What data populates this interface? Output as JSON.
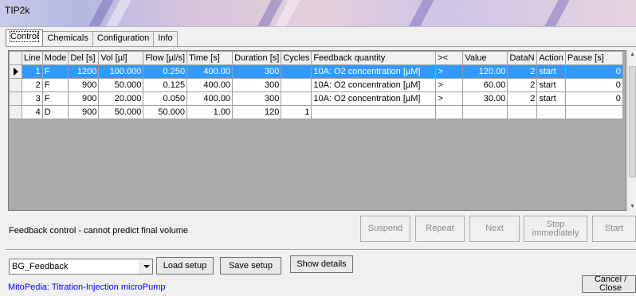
{
  "window": {
    "title": "TIP2k"
  },
  "tabs": [
    {
      "label": "Control",
      "active": true
    },
    {
      "label": "Chemicals",
      "active": false
    },
    {
      "label": "Configuration",
      "active": false
    },
    {
      "label": "Info",
      "active": false
    }
  ],
  "grid": {
    "columns": [
      "Line",
      "Mode",
      "Del [s]",
      "Vol [µl]",
      "Flow [µl/s]",
      "Time [s]",
      "Duration [s]",
      "Cycles",
      "Feedback quantity",
      "><",
      "Value",
      "DataN",
      "Action",
      "Pause [s]"
    ],
    "rows": [
      {
        "line": "1",
        "mode": "F",
        "del": "1200",
        "vol": "100.000",
        "flow": "0.250",
        "time": "400.00",
        "duration": "300",
        "cycles": "",
        "feedback": "10A: O2 concentration [µM]",
        "cmp": ">",
        "value": "120.00",
        "datan": "2",
        "action": "start",
        "pause": "0",
        "selected": true
      },
      {
        "line": "2",
        "mode": "F",
        "del": "900",
        "vol": "50.000",
        "flow": "0.125",
        "time": "400.00",
        "duration": "300",
        "cycles": "",
        "feedback": "10A: O2 concentration [µM]",
        "cmp": ">",
        "value": "60.00",
        "datan": "2",
        "action": "start",
        "pause": "0",
        "selected": false
      },
      {
        "line": "3",
        "mode": "F",
        "del": "900",
        "vol": "20.000",
        "flow": "0.050",
        "time": "400.00",
        "duration": "300",
        "cycles": "",
        "feedback": "10A: O2 concentration [µM]",
        "cmp": ">",
        "value": "30.00",
        "datan": "2",
        "action": "start",
        "pause": "0",
        "selected": false
      },
      {
        "line": "4",
        "mode": "D",
        "del": "900",
        "vol": "50.000",
        "flow": "50.000",
        "time": "1.00",
        "duration": "120",
        "cycles": "1",
        "feedback": "",
        "cmp": "",
        "value": "",
        "datan": "",
        "action": "",
        "pause": "",
        "selected": false
      }
    ]
  },
  "status": {
    "message": "Feedback control - cannot predict final volume"
  },
  "controls": {
    "suspend": "Suspend",
    "repeat": "Repeat",
    "next": "Next",
    "stop_line1": "Stop",
    "stop_line2": "immediately",
    "start": "Start"
  },
  "setup": {
    "selected": "BG_Feedback",
    "load": "Load setup",
    "save": "Save setup",
    "details": "Show details"
  },
  "footer": {
    "link": "MitoPedia: Titration-Injection microPump",
    "cancel": "Cancel / Close"
  },
  "colors": {
    "selection": "#3399ff",
    "link": "#0000ff"
  }
}
